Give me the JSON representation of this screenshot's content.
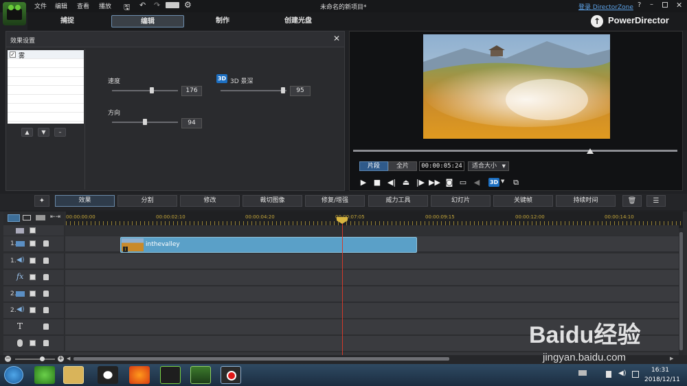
{
  "app": {
    "project_title": "未命名的新项目*",
    "brand": "PowerDirector",
    "login_link": "登录 DirectorZone",
    "help": "?"
  },
  "menu": [
    "文件",
    "编辑",
    "查看",
    "播放"
  ],
  "modes": [
    "捕捉",
    "编辑",
    "制作",
    "创建光盘"
  ],
  "effect_panel": {
    "title": "效果设置",
    "list": [
      {
        "label": "雾",
        "checked": true
      }
    ],
    "speed": {
      "label": "速度",
      "value": "176",
      "level": 0.6
    },
    "depth": {
      "label": "3D 景深",
      "value": "95",
      "level": 0.95
    },
    "direction": {
      "label": "方向",
      "value": "94",
      "level": 0.5
    }
  },
  "preview": {
    "tab_clip": "片段",
    "tab_full": "全片",
    "timecode": "00:00:05:24",
    "fit": "适合大小",
    "seek_level": 0.73
  },
  "toolbar": [
    "效果",
    "分割",
    "修改",
    "裁切图像",
    "修复/增强",
    "威力工具",
    "幻灯片",
    "关键帧",
    "持续时间"
  ],
  "timeline": {
    "ticks": [
      "00:00:00:00",
      "00:00:02:10",
      "00:00:04:20",
      "00:00:07:05",
      "00:00:09:15",
      "00:00:12:00",
      "00:00:14:10"
    ],
    "tracks": [
      {
        "num": "",
        "icon": "video-icon"
      },
      {
        "num": "1.",
        "icon": "video-icon"
      },
      {
        "num": "1.",
        "icon": "audio-icon"
      },
      {
        "num": "",
        "icon": "fx-icon",
        "label": "fx"
      },
      {
        "num": "2.",
        "icon": "video-icon"
      },
      {
        "num": "2.",
        "icon": "audio-icon"
      },
      {
        "num": "",
        "icon": "text-icon",
        "label": "T"
      },
      {
        "num": "",
        "icon": "mic-icon"
      }
    ],
    "clip_name": "inthevalley"
  },
  "taskbar": {
    "time": "16:31",
    "date": "2018/12/11"
  },
  "watermark": {
    "text": "Baidu经验",
    "url": "jingyan.baidu.com"
  }
}
